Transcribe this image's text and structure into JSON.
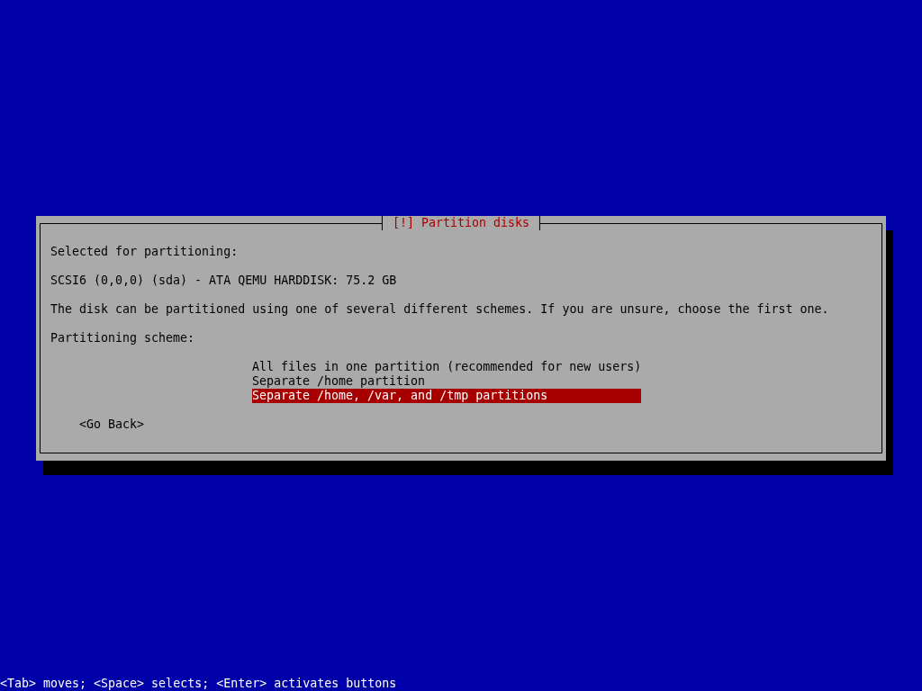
{
  "dialog": {
    "title": "[!] Partition disks",
    "paragraphs": [
      "Selected for partitioning:",
      "SCSI6 (0,0,0) (sda) - ATA QEMU HARDDISK: 75.2 GB",
      "The disk can be partitioned using one of several different schemes. If you are unsure, choose the first one.",
      "Partitioning scheme:"
    ],
    "options": [
      {
        "label": "All files in one partition (recommended for new users)",
        "selected": false
      },
      {
        "label": "Separate /home partition",
        "selected": false
      },
      {
        "label": "Separate /home, /var, and /tmp partitions",
        "selected": true
      }
    ],
    "back_button": "<Go Back>"
  },
  "status_bar": "<Tab> moves; <Space> selects; <Enter> activates buttons"
}
